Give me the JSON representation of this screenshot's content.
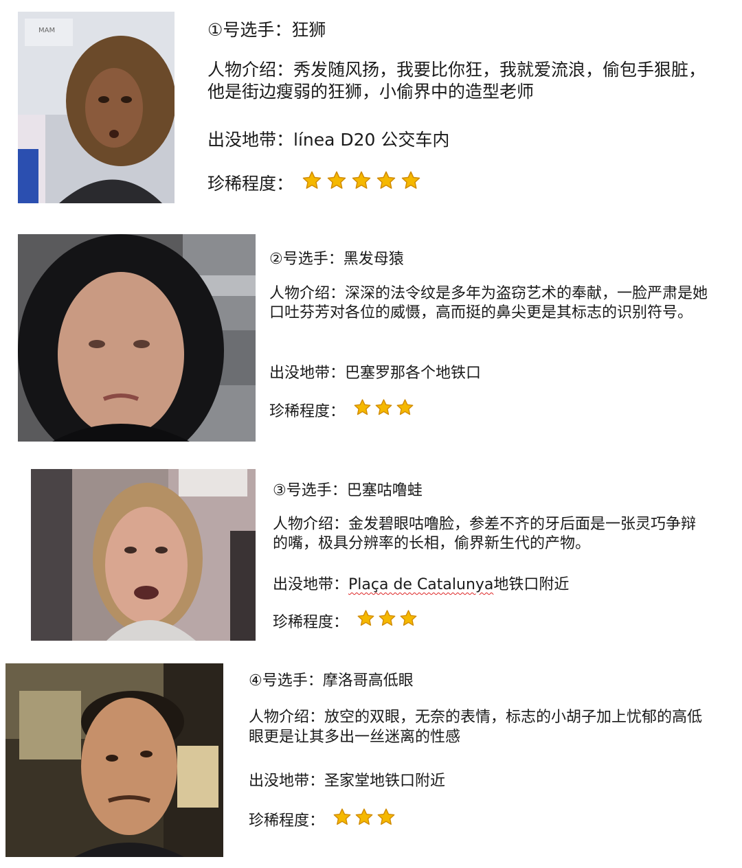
{
  "cards": [
    {
      "title": "①号选手：狂狮",
      "intro": "人物介绍：秀发随风扬，我要比你狂，我就爱流浪，偷包手狠脏，他是街边瘦弱的狂狮，小偷界中的造型老师",
      "location_label": "出没地带：",
      "location_value": "línea D20 公交车内",
      "rarity_label": "珍稀程度：",
      "rarity_stars": 5,
      "photo_text": "MAM"
    },
    {
      "title": "②号选手：黑发母猿",
      "intro": "人物介绍：深深的法令纹是多年为盗窃艺术的奉献，一脸严肃是她口吐芬芳对各位的威慑，高而挺的鼻尖更是其标志的识别符号。",
      "location_label": "出没地带：",
      "location_value": "巴塞罗那各个地铁口",
      "rarity_label": "珍稀程度：",
      "rarity_stars": 3
    },
    {
      "title": "③号选手：巴塞咕噜蛙",
      "intro": "人物介绍：金发碧眼咕噜脸，参差不齐的牙后面是一张灵巧争辩的嘴，极具分辨率的长相，偷界新生代的产物。",
      "location_label": "出没地带：",
      "location_value_underlined": "Plaça de Catalunya",
      "location_value_rest": "地铁口附近",
      "rarity_label": "珍稀程度：",
      "rarity_stars": 3
    },
    {
      "title": "④号选手：摩洛哥高低眼",
      "intro": "人物介绍：放空的双眼，无奈的表情，标志的小胡子加上忧郁的高低眼更是让其多出一丝迷离的性感",
      "location_label": "出没地带：",
      "location_value": "圣家堂地铁口附近",
      "rarity_label": "珍稀程度：",
      "rarity_stars": 3
    }
  ],
  "colors": {
    "star": "#f5b800",
    "star_edge": "#d08a00",
    "text": "#1a1a1a"
  }
}
